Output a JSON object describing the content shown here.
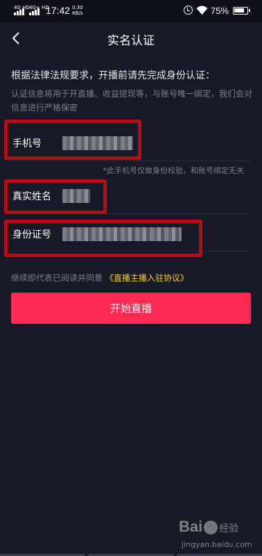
{
  "status_bar": {
    "signal1": "4G HD",
    "signal2": "4G+ HD",
    "time": "17:42",
    "speed_value": "0.30",
    "speed_unit": "KB/s",
    "battery": "75%"
  },
  "header": {
    "title": "实名认证"
  },
  "intro": {
    "title": "根据法律法规要求，开播前请先完成身份认证：",
    "description": "认证信息将用于开直播、收益提现等，与账号唯一绑定，我们会对信息进行严格保密"
  },
  "fields": [
    {
      "label": "手机号"
    },
    {
      "label": "真实姓名"
    },
    {
      "label": "身份证号"
    }
  ],
  "phone_note": "*此手机号仅做身份校验，和账号绑定无关",
  "agreement": {
    "prefix": "继续即代表已阅读并同意",
    "link": "《直播主播入驻协议》"
  },
  "start_button": "开始直播",
  "watermark": {
    "brand_left": "Bai",
    "brand_right": "经验",
    "url": "jingyan.baidu.com"
  },
  "colors": {
    "background": "#171a26",
    "primary": "#fe2c55",
    "link": "#f2c744",
    "annotation": "#b20f17"
  },
  "icons": {
    "back": "chevron-left-icon",
    "wifi": "wifi-icon",
    "alarm": "alarm-icon",
    "battery": "battery-icon"
  }
}
